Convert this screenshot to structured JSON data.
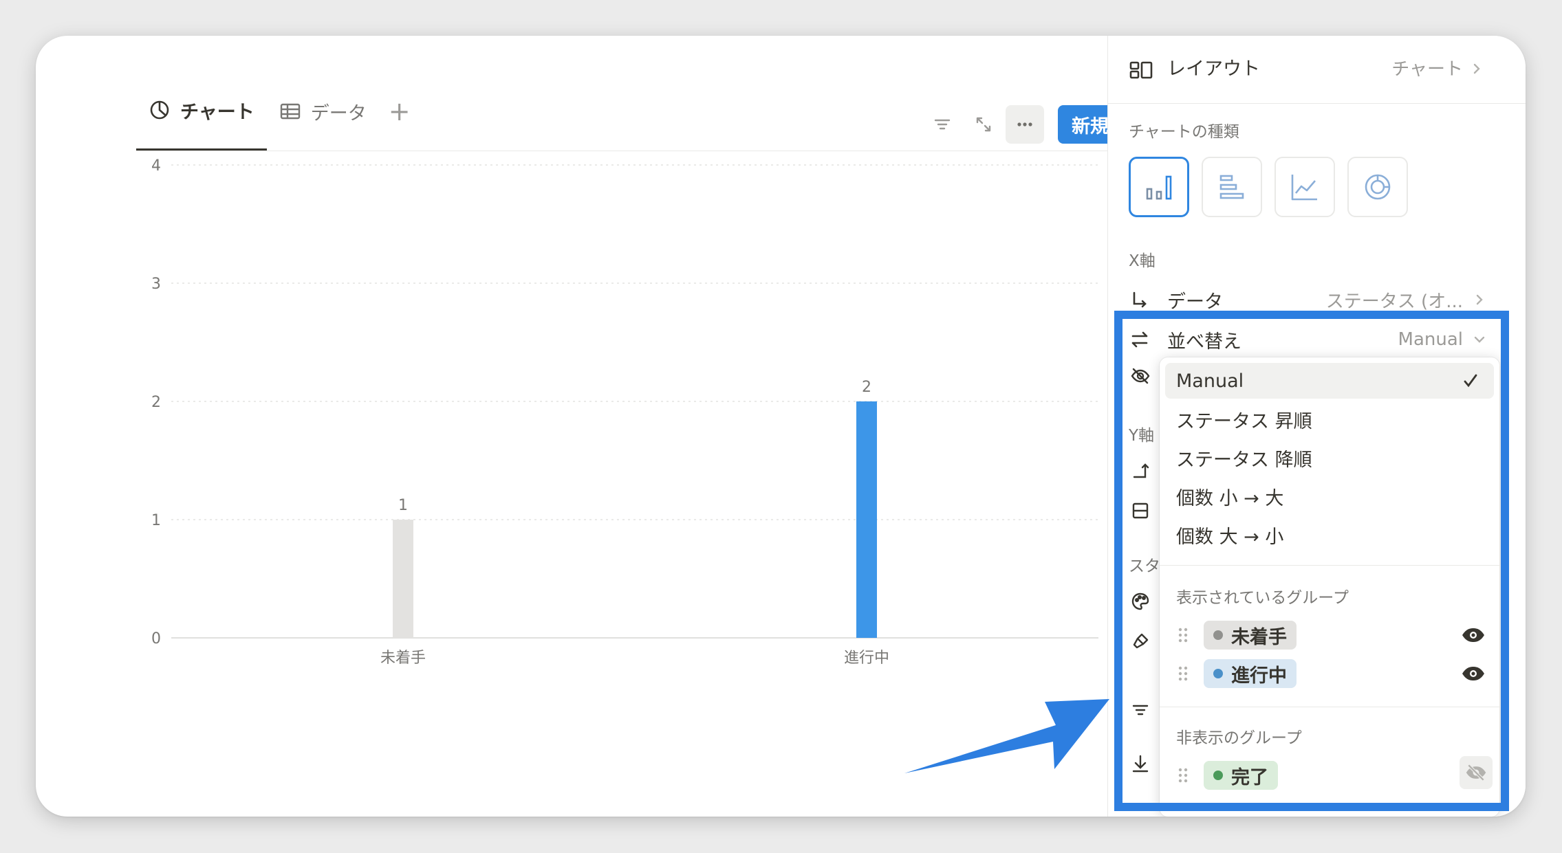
{
  "tabs": {
    "chart": "チャート",
    "data": "データ",
    "add": "+"
  },
  "toolbar": {
    "new_label": "新規"
  },
  "chart_data": {
    "type": "bar",
    "categories": [
      "未着手",
      "進行中"
    ],
    "values": [
      1,
      2
    ],
    "colors": [
      "#e3e2e0",
      "#3d96e8"
    ],
    "data_labels": [
      "1",
      "2"
    ],
    "y_ticks": [
      "0",
      "1",
      "2",
      "3",
      "4"
    ],
    "ylim": [
      0,
      4
    ],
    "grid": true
  },
  "panel": {
    "header_title": "レイアウト",
    "header_value": "チャート",
    "chart_type_label": "チャートの種類",
    "chart_types": [
      "vertical-bar",
      "horizontal-bar",
      "line",
      "donut"
    ],
    "selected_chart_type": "vertical-bar",
    "x_axis_label": "X軸",
    "data_label": "データ",
    "data_value": "ステータス (オ...",
    "sort_label": "並べ替え",
    "sort_value": "Manual",
    "y_axis_label": "Y軸",
    "style_label": "スタ"
  },
  "dropdown": {
    "options": [
      "Manual",
      "ステータス 昇順",
      "ステータス 降順",
      "個数 小 → 大",
      "個数 大 → 小"
    ],
    "selected": "Manual",
    "visible_groups_label": "表示されているグループ",
    "visible_groups": [
      {
        "name": "未着手",
        "dot": "#91918e",
        "bg": "#e3e2e0"
      },
      {
        "name": "進行中",
        "dot": "#4a90c9",
        "bg": "#d9e7f3"
      }
    ],
    "hidden_groups_label": "非表示のグループ",
    "hidden_groups": [
      {
        "name": "完了",
        "dot": "#4b9a5a",
        "bg": "#dbeddb"
      }
    ]
  },
  "colors": {
    "accent": "#2f86e0",
    "highlight": "#2d7ee0"
  }
}
